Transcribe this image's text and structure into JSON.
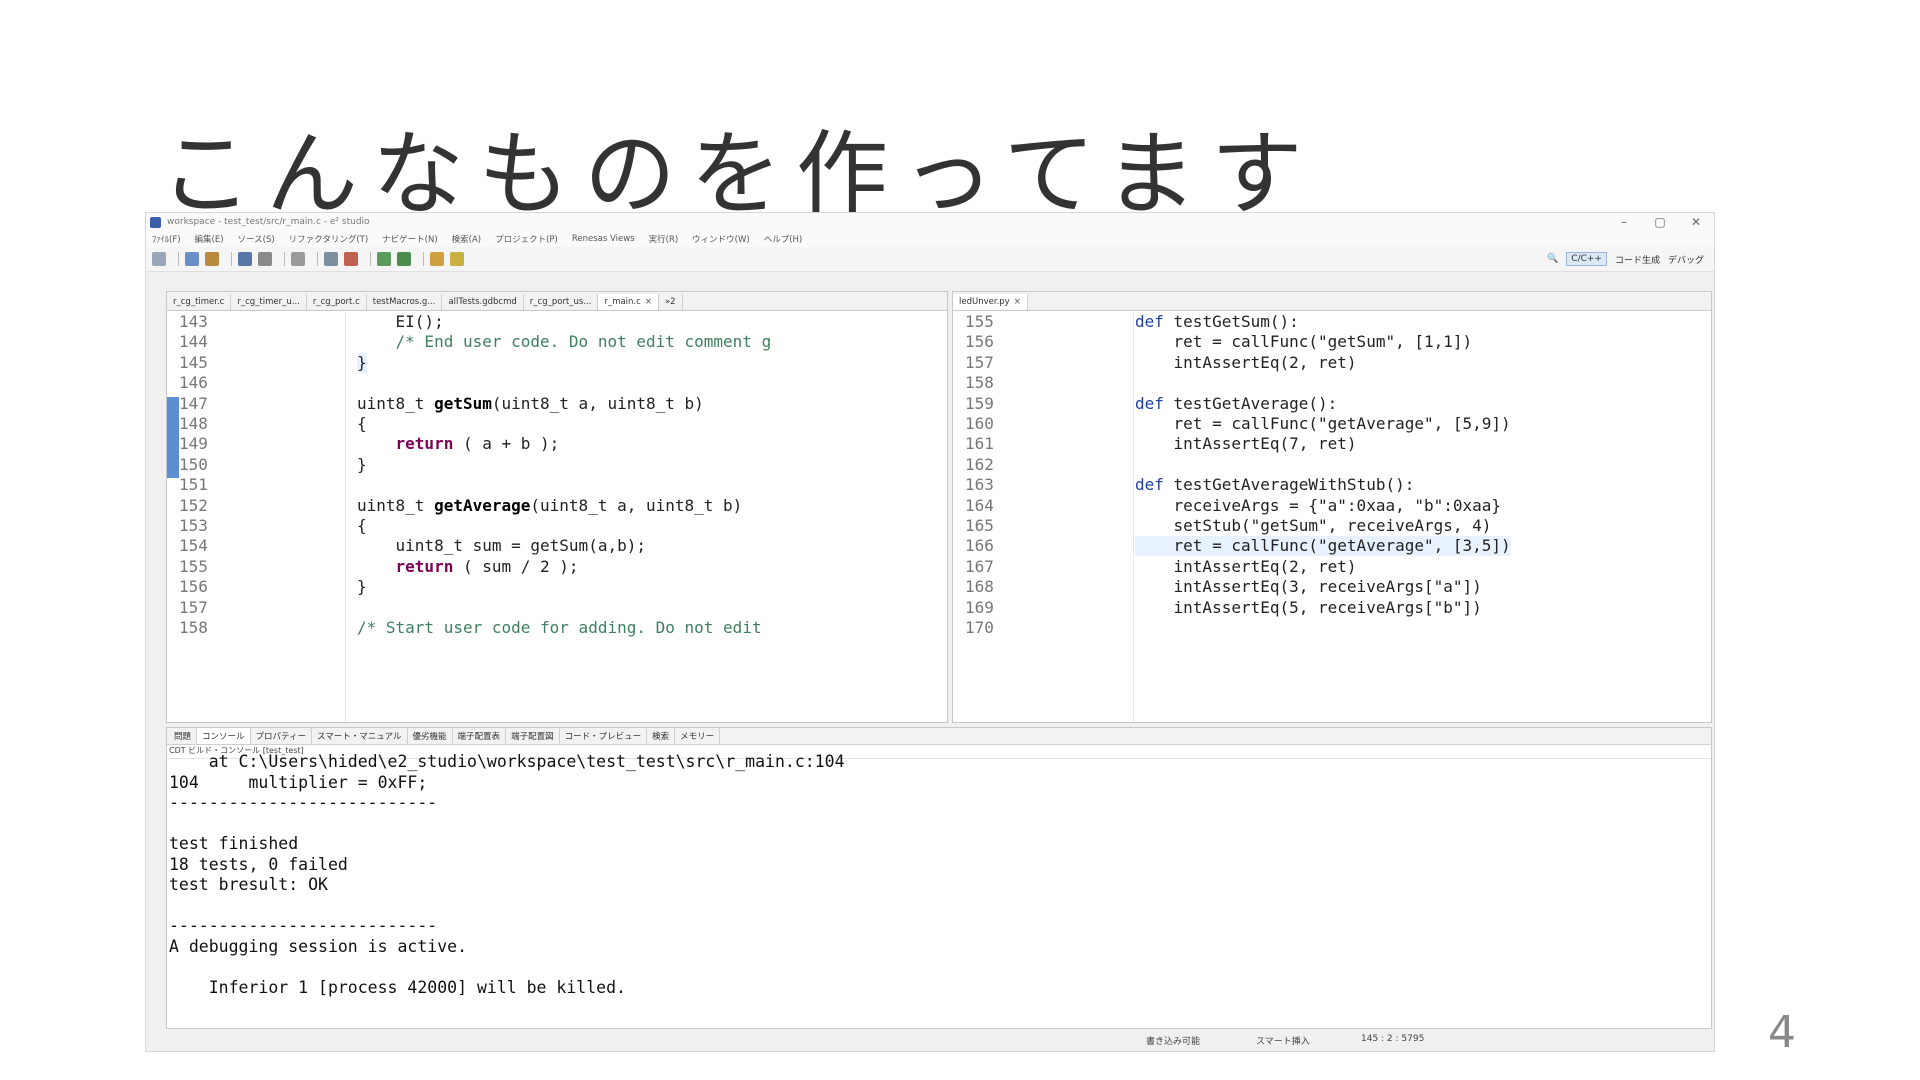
{
  "slide": {
    "title": "こんなものを作ってます",
    "page_number": "4"
  },
  "window": {
    "title": "workspace - test_test/src/r_main.c - e² studio",
    "controls": [
      "–",
      "▢",
      "✕"
    ]
  },
  "menu": [
    "ﾌｧｲﾙ(F)",
    "編集(E)",
    "ソース(S)",
    "リファクタリング(T)",
    "ナビゲート(N)",
    "検索(A)",
    "プロジェクト(P)",
    "Renesas Views",
    "実行(R)",
    "ウィンドウ(W)",
    "ヘルプ(H)"
  ],
  "toolbar_right": {
    "perspective_cpp": "C/C++",
    "perspective_codegen": "コード生成",
    "perspective_debug": "デバッグ"
  },
  "left_editor": {
    "tabs": [
      {
        "label": "r_cg_timer.c",
        "active": false
      },
      {
        "label": "r_cg_timer_u...",
        "active": false
      },
      {
        "label": "r_cg_port.c",
        "active": false
      },
      {
        "label": "testMacros.g...",
        "active": false
      },
      {
        "label": "allTests.gdbcmd",
        "active": false
      },
      {
        "label": "r_cg_port_us...",
        "active": false
      },
      {
        "label": "r_main.c",
        "active": true
      }
    ],
    "overflow": "»2",
    "lines": [
      {
        "n": "143",
        "text": "    EI();"
      },
      {
        "n": "144",
        "text": "    /* End user code. Do not edit comment g"
      },
      {
        "n": "145",
        "text": "}"
      },
      {
        "n": "146",
        "text": ""
      },
      {
        "n": "147",
        "text": "uint8_t getSum(uint8_t a, uint8_t b)"
      },
      {
        "n": "148",
        "text": "{"
      },
      {
        "n": "149",
        "text": "    return ( a + b );"
      },
      {
        "n": "150",
        "text": "}"
      },
      {
        "n": "151",
        "text": ""
      },
      {
        "n": "152",
        "text": "uint8_t getAverage(uint8_t a, uint8_t b)"
      },
      {
        "n": "153",
        "text": "{"
      },
      {
        "n": "154",
        "text": "    uint8_t sum = getSum(a,b);"
      },
      {
        "n": "155",
        "text": "    return ( sum / 2 );"
      },
      {
        "n": "156",
        "text": "}"
      },
      {
        "n": "157",
        "text": ""
      },
      {
        "n": "158",
        "text": "/* Start user code for adding. Do not edit"
      }
    ]
  },
  "right_editor": {
    "tabs": [
      {
        "label": "ledUnver.py",
        "active": true
      }
    ],
    "lines": [
      {
        "n": "155",
        "text": "def testGetSum():"
      },
      {
        "n": "156",
        "text": "    ret = callFunc(\"getSum\", [1,1])"
      },
      {
        "n": "157",
        "text": "    intAssertEq(2, ret)"
      },
      {
        "n": "158",
        "text": ""
      },
      {
        "n": "159",
        "text": "def testGetAverage():"
      },
      {
        "n": "160",
        "text": "    ret = callFunc(\"getAverage\", [5,9])"
      },
      {
        "n": "161",
        "text": "    intAssertEq(7, ret)"
      },
      {
        "n": "162",
        "text": ""
      },
      {
        "n": "163",
        "text": "def testGetAverageWithStub():"
      },
      {
        "n": "164",
        "text": "    receiveArgs = {\"a\":0xaa, \"b\":0xaa}"
      },
      {
        "n": "165",
        "text": "    setStub(\"getSum\", receiveArgs, 4)"
      },
      {
        "n": "166",
        "text": "    ret = callFunc(\"getAverage\", [3,5])"
      },
      {
        "n": "167",
        "text": "    intAssertEq(2, ret)"
      },
      {
        "n": "168",
        "text": "    intAssertEq(3, receiveArgs[\"a\"])"
      },
      {
        "n": "169",
        "text": "    intAssertEq(5, receiveArgs[\"b\"])"
      },
      {
        "n": "170",
        "text": ""
      }
    ]
  },
  "bottom_views": {
    "tabs": [
      "問題",
      "コンソール",
      "プロパティー",
      "スマート・マニュアル",
      "優劣機能",
      "端子配置表",
      "端子配置図",
      "コード・プレビュー",
      "検索",
      "メモリー"
    ],
    "active_tab": "コンソール",
    "console_name": "CDT ビルド・コンソール [test_test]",
    "console_lines": [
      "    at C:\\Users\\hided\\e2_studio\\workspace\\test_test\\src\\r_main.c:104",
      "104     multiplier = 0xFF;",
      "---------------------------",
      "",
      "test finished",
      "18 tests, 0 failed",
      "test bresult: OK",
      "",
      "---------------------------",
      "A debugging session is active.",
      "",
      "    Inferior 1 [process 42000] will be killed."
    ]
  },
  "status_bar": {
    "writable": "書き込み可能",
    "insert_mode": "スマート挿入",
    "position": "145 : 2 : 5795"
  },
  "colors": {
    "keyword": "#7f0055",
    "comment": "#3f7f5f",
    "highlight": "#e8f2fe",
    "marker": "#5b8fd0"
  }
}
